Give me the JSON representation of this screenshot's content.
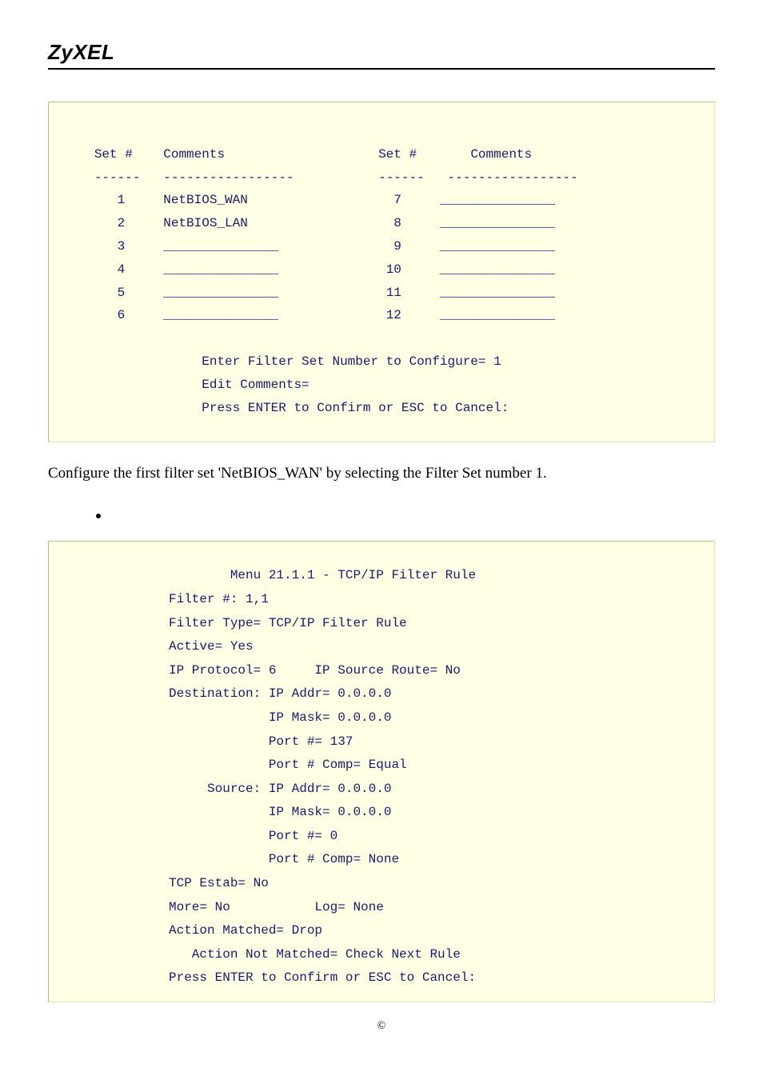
{
  "brand": "ZyXEL",
  "filter_set_table": {
    "hdr_set": "Set #",
    "hdr_comments": "Comments",
    "dash_set": "------",
    "dash_comments": "-----------------",
    "left": [
      {
        "n": "1",
        "c": "NetBIOS_WAN"
      },
      {
        "n": "2",
        "c": "NetBIOS_LAN"
      },
      {
        "n": "3",
        "c": "_______________"
      },
      {
        "n": "4",
        "c": "_______________"
      },
      {
        "n": "5",
        "c": "_______________"
      },
      {
        "n": "6",
        "c": "_______________"
      }
    ],
    "right": [
      {
        "n": "7",
        "c": "_______________"
      },
      {
        "n": "8",
        "c": "_______________"
      },
      {
        "n": "9",
        "c": "_______________"
      },
      {
        "n": "10",
        "c": "_______________"
      },
      {
        "n": "11",
        "c": "_______________"
      },
      {
        "n": "12",
        "c": "_______________"
      }
    ],
    "prompt1": "Enter Filter Set Number to Configure= 1",
    "prompt2": "Edit Comments=",
    "prompt3": "Press ENTER to Confirm or ESC to Cancel:"
  },
  "narrative": "Configure the first filter set 'NetBIOS_WAN' by selecting the Filter Set number 1.",
  "rule_menu": {
    "title": "Menu 21.1.1 - TCP/IP Filter Rule",
    "lines": [
      "Filter #: 1,1",
      "Filter Type= TCP/IP Filter Rule",
      "Active= Yes",
      "IP Protocol= 6     IP Source Route= No",
      "Destination: IP Addr= 0.0.0.0",
      "             IP Mask= 0.0.0.0",
      "             Port #= 137",
      "             Port # Comp= Equal",
      "     Source: IP Addr= 0.0.0.0",
      "             IP Mask= 0.0.0.0",
      "             Port #= 0",
      "             Port # Comp= None",
      "TCP Estab= No",
      "More= No           Log= None",
      "Action Matched= Drop",
      "   Action Not Matched= Check Next Rule",
      "Press ENTER to Confirm or ESC to Cancel:"
    ]
  },
  "footer": "©"
}
